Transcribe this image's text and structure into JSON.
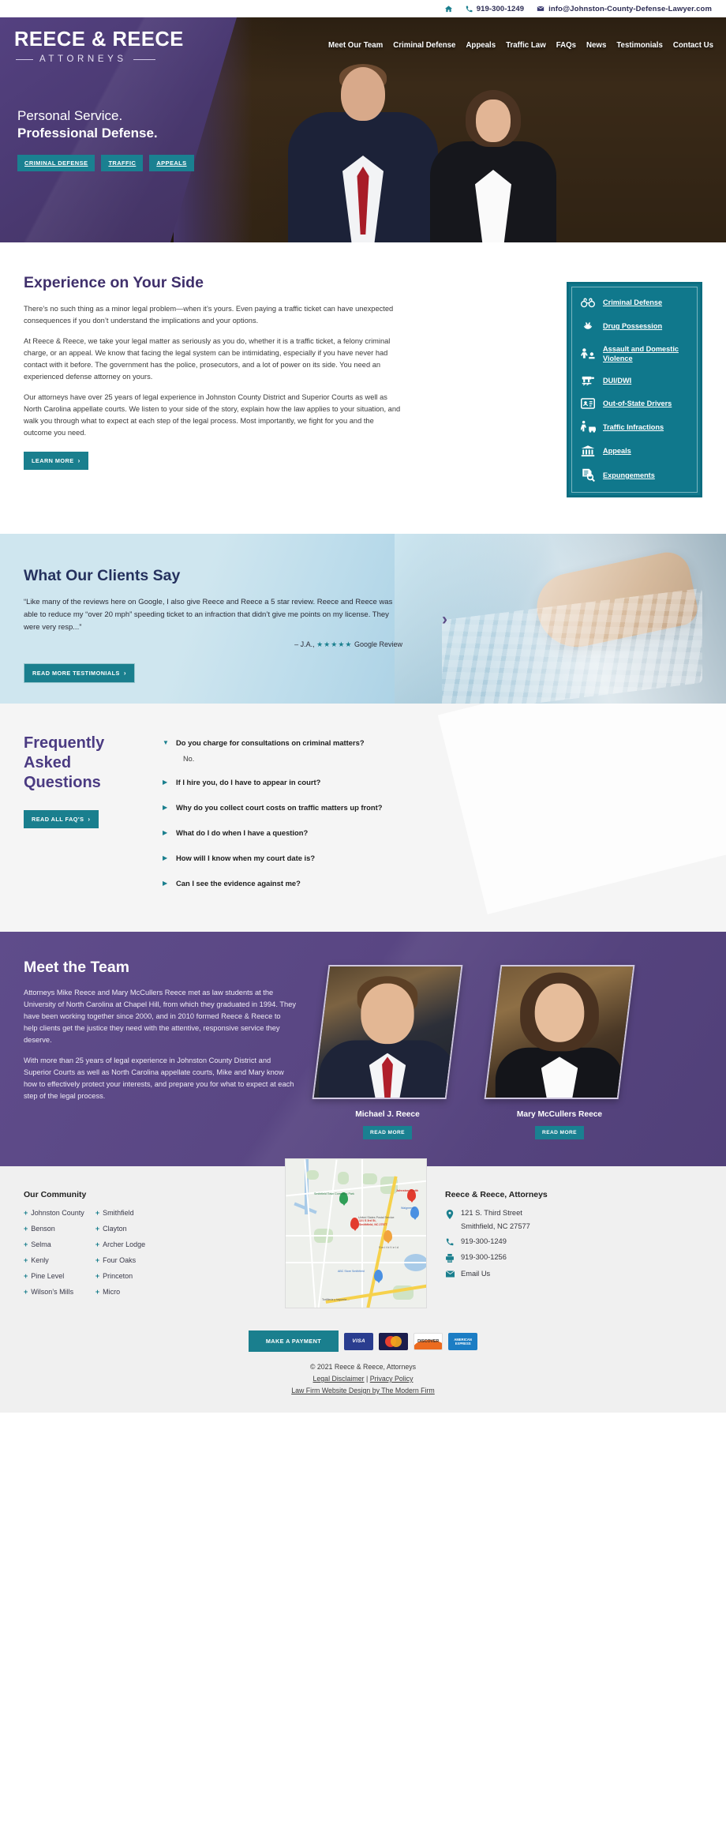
{
  "topbar": {
    "home_icon": "home-icon",
    "phone_icon": "phone-icon",
    "phone": "919-300-1249",
    "email_icon": "envelope-icon",
    "email": "info@Johnston-County-Defense-Lawyer.com"
  },
  "logo": {
    "name": "REECE & REECE",
    "tagline": "ATTORNEYS"
  },
  "nav": {
    "items": [
      {
        "label": "Meet Our Team"
      },
      {
        "label": "Criminal Defense"
      },
      {
        "label": "Appeals"
      },
      {
        "label": "Traffic Law"
      },
      {
        "label": "FAQs"
      },
      {
        "label": "News"
      },
      {
        "label": "Testimonials"
      },
      {
        "label": "Contact Us"
      }
    ]
  },
  "hero": {
    "line1": "Personal Service.",
    "line2": "Professional Defense.",
    "badges": [
      "CRIMINAL DEFENSE",
      "TRAFFIC",
      "APPEALS"
    ]
  },
  "experience": {
    "title": "Experience on Your Side",
    "paragraphs": [
      "There’s no such thing as a minor legal problem—when it’s yours. Even paying a traffic ticket can have unexpected consequences if you don’t understand the implications and your options.",
      "At Reece & Reece, we take your legal matter as seriously as you do, whether it is a traffic ticket, a felony criminal charge, or an appeal. We know that facing the legal system can be intimidating, especially if you have never had contact with it before. The government has the police, prosecutors, and a lot of power on its side. You need an experienced defense attorney on yours.",
      "Our attorneys have over 25 years of legal experience in Johnston County District and Superior Courts as well as North Carolina appellate courts. We listen to your side of the story, explain how the law applies to your situation, and walk you through what to expect at each step of the legal process. Most importantly, we fight for you and the outcome you need."
    ],
    "learn_more_label": "LEARN MORE",
    "chevron": "›"
  },
  "practice_areas": {
    "items": [
      {
        "label": "Criminal Defense",
        "icon": "handcuffs-icon"
      },
      {
        "label": "Drug Possession",
        "icon": "cannabis-leaf-icon"
      },
      {
        "label": "Assault and Domestic Violence",
        "icon": "assault-icon"
      },
      {
        "label": "DUI/DWI",
        "icon": "breathalyzer-icon"
      },
      {
        "label": "Out-of-State Drivers",
        "icon": "id-card-icon"
      },
      {
        "label": "Traffic Infractions",
        "icon": "pedestrian-car-icon"
      },
      {
        "label": "Appeals",
        "icon": "courthouse-icon"
      },
      {
        "label": "Expungements",
        "icon": "document-magnifier-icon"
      }
    ]
  },
  "testimonials": {
    "title": "What Our Clients Say",
    "quote": "“Like many of the reviews here on Google, I also give Reece and Reece a 5 star review. Reece and Reece was able to reduce my “over 20 mph” speeding ticket to an infraction that didn’t give me points on my license. They were very resp...”",
    "author": "– J.A.,",
    "stars": "★★★★★",
    "source": "Google Review",
    "button_label": "READ MORE TESTIMONIALS",
    "next_arrow": "›"
  },
  "faq": {
    "title": "Frequently Asked Questions",
    "button_label": "READ ALL FAQ'S",
    "items": [
      {
        "question": "Do you charge for consultations on criminal matters?",
        "answer": "No.",
        "expanded": true,
        "marker": "▼"
      },
      {
        "question": "If I hire you, do I have to appear in court?",
        "expanded": false,
        "marker": "▶"
      },
      {
        "question": "Why do you collect court costs on traffic matters up front?",
        "expanded": false,
        "marker": "▶"
      },
      {
        "question": "What do I do when I have a question?",
        "expanded": false,
        "marker": "▶"
      },
      {
        "question": "How will I know when my court date is?",
        "expanded": false,
        "marker": "▶"
      },
      {
        "question": "Can I see the evidence against me?",
        "expanded": false,
        "marker": "▶"
      }
    ]
  },
  "team": {
    "title": "Meet the Team",
    "paragraphs": [
      "Attorneys Mike Reece and Mary McCullers Reece met as law students at the University of North Carolina at Chapel Hill, from which they graduated in 1994. They have been working together since 2000, and in 2010 formed Reece & Reece to help clients get the justice they need with the attentive, responsive service they deserve.",
      "With more than 25 years of legal experience in Johnston County District and Superior Courts as well as North Carolina appellate courts, Mike and Mary know how to effectively protect your interests, and prepare you for what to expect at each step of the legal process."
    ],
    "members": [
      {
        "name": "Michael J. Reece",
        "button_label": "READ MORE"
      },
      {
        "name": "Mary McCullers Reece",
        "button_label": "READ MORE"
      }
    ]
  },
  "footer": {
    "community": {
      "title": "Our Community",
      "col1": [
        "Johnston County",
        "Benson",
        "Selma",
        "Kenly",
        "Pine Level",
        "Wilson’s Mills"
      ],
      "col2": [
        "Smithfield",
        "Clayton",
        "Archer Lodge",
        "Four Oaks",
        "Princeton",
        "Micro"
      ],
      "plus": "+"
    },
    "map": {
      "pin_label_line1": "121 S 3rd St,",
      "pin_label_line2": "Smithfield, NC 27577",
      "labels": [
        "Smithfield Town Commons Park",
        "United States Postal Service",
        "Johnston Health",
        "Walgreens",
        "Smithfield",
        "ABC Store Smithfield",
        "Tortilleria y taqueria ..."
      ]
    },
    "contact": {
      "title": "Reece & Reece, Attorneys",
      "address_line1": "121 S. Third Street",
      "address_line2": "Smithfield, NC 27577",
      "phone": "919-300-1249",
      "fax": "919-300-1256",
      "email_label": "Email Us",
      "location_icon": "map-pin-icon",
      "phone_icon": "phone-icon",
      "fax_icon": "fax-icon",
      "email_icon": "envelope-icon"
    },
    "payment": {
      "button_label": "MAKE A PAYMENT",
      "cards": [
        "VISA",
        "MASTERCARD",
        "DISCOVER",
        "AMERICAN EXPRESS"
      ]
    },
    "copyright": "© 2021 Reece & Reece, Attorneys",
    "legal_disclaimer": "Legal Disclaimer",
    "separator": "|",
    "privacy_policy": "Privacy Policy",
    "credit": "Law Firm Website Design by The Modern Firm"
  },
  "colors": {
    "purple": "#4b3b77",
    "teal": "#1a7f8e",
    "deep_purple_text": "#3f2f6b",
    "navy": "#25315e"
  }
}
